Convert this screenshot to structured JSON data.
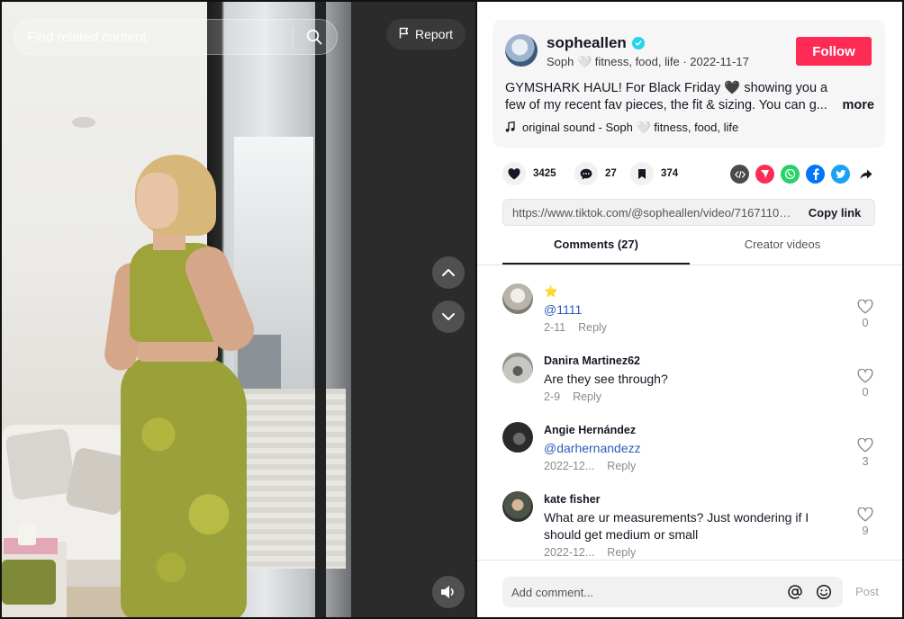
{
  "search": {
    "placeholder": "Find related content"
  },
  "video": {
    "report_label": "Report"
  },
  "author": {
    "username": "sopheallen",
    "subtitle": "Soph 🤍 fitness, food, life · 2022-11-17",
    "follow_label": "Follow",
    "caption_line1": "GYMSHARK HAUL! For Black Friday 🖤 showing you a",
    "caption_line2": "few of my recent fav pieces, the fit & sizing. You can g...",
    "more_label": "more",
    "music": "original sound - Soph 🤍 fitness, food, life"
  },
  "actions": {
    "likes": "3425",
    "comments": "27",
    "saves": "374"
  },
  "share": {
    "link": "https://www.tiktok.com/@sopheallen/video/71671100...",
    "copy_label": "Copy link"
  },
  "tabs": {
    "comments_label": "Comments (27)",
    "creator_label": "Creator videos"
  },
  "comments": [
    {
      "user": "⭐",
      "text": "@1111",
      "date": "2-11",
      "reply": "Reply",
      "likes": "0",
      "mention": true
    },
    {
      "user": "Danira Martinez62",
      "text": "Are they see through?",
      "date": "2-9",
      "reply": "Reply",
      "likes": "0",
      "mention": false
    },
    {
      "user": "Angie Hernández",
      "text": "@darhernandezz",
      "date": "2022-12...",
      "reply": "Reply",
      "likes": "3",
      "mention": true
    },
    {
      "user": "kate fisher",
      "text": "What are ur measurements? Just wondering if I should get medium or small",
      "date": "2022-12...",
      "reply": "Reply",
      "likes": "9",
      "mention": false
    }
  ],
  "compose": {
    "placeholder": "Add comment...",
    "post_label": "Post"
  },
  "colors": {
    "follow": "#fe2c55",
    "verified": "#20d5ec",
    "mention": "#2b5db9"
  }
}
